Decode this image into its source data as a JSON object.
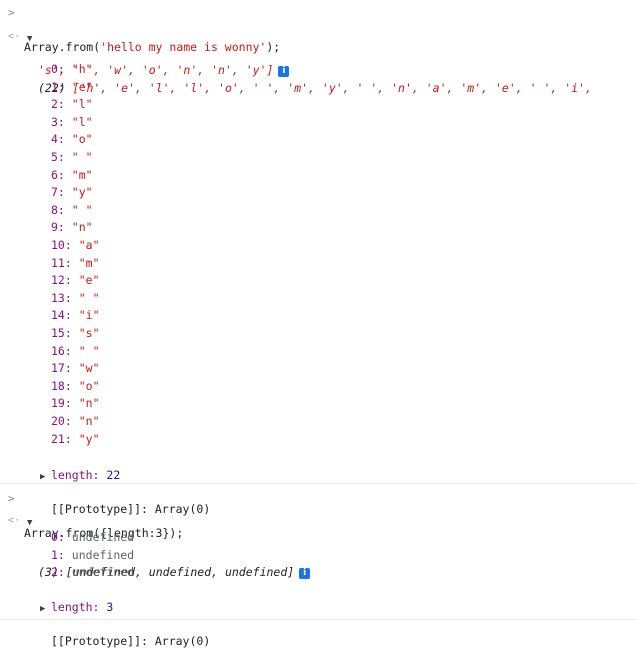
{
  "entries": [
    {
      "input": "Array.from('hello my name is wonny');",
      "input_prefix": "Array.from(",
      "input_string": "'hello my name is wonny'",
      "input_suffix": ");",
      "count": "(22)",
      "preview_line1": "['h', 'e', 'l', 'l', 'o', ' ', 'm', 'y', ' ', 'n', 'a', 'm', 'e', ' ', 'i',",
      "preview_line2": "'s', ' ', 'w', 'o', 'n', 'n', 'y']",
      "items": [
        {
          "key": "0:",
          "value": "\"h\""
        },
        {
          "key": "1:",
          "value": "\"e\""
        },
        {
          "key": "2:",
          "value": "\"l\""
        },
        {
          "key": "3:",
          "value": "\"l\""
        },
        {
          "key": "4:",
          "value": "\"o\""
        },
        {
          "key": "5:",
          "value": "\" \""
        },
        {
          "key": "6:",
          "value": "\"m\""
        },
        {
          "key": "7:",
          "value": "\"y\""
        },
        {
          "key": "8:",
          "value": "\" \""
        },
        {
          "key": "9:",
          "value": "\"n\""
        },
        {
          "key": "10:",
          "value": "\"a\""
        },
        {
          "key": "11:",
          "value": "\"m\""
        },
        {
          "key": "12:",
          "value": "\"e\""
        },
        {
          "key": "13:",
          "value": "\" \""
        },
        {
          "key": "14:",
          "value": "\"i\""
        },
        {
          "key": "15:",
          "value": "\"s\""
        },
        {
          "key": "16:",
          "value": "\" \""
        },
        {
          "key": "17:",
          "value": "\"w\""
        },
        {
          "key": "18:",
          "value": "\"o\""
        },
        {
          "key": "19:",
          "value": "\"n\""
        },
        {
          "key": "20:",
          "value": "\"n\""
        },
        {
          "key": "21:",
          "value": "\"y\""
        }
      ],
      "length_key": "length:",
      "length_value": "22",
      "prototype": "[[Prototype]]: Array(0)"
    },
    {
      "input": "Array.from({length:3});",
      "count": "(3)",
      "preview_line1": "[undefined, undefined, undefined]",
      "items": [
        {
          "key": "0:",
          "value": "undefined"
        },
        {
          "key": "1:",
          "value": "undefined"
        },
        {
          "key": "2:",
          "value": "undefined"
        }
      ],
      "length_key": "length:",
      "length_value": "3",
      "prototype": "[[Prototype]]: Array(0)"
    }
  ],
  "icons": {
    "prompt": ">",
    "result": "<·",
    "expanded": "▼",
    "collapsed": "▶",
    "info": "i"
  },
  "colors": {
    "string": "#c41a16",
    "key": "#881280",
    "number": "#1a1aa6",
    "info_badge": "#1a73e8"
  }
}
